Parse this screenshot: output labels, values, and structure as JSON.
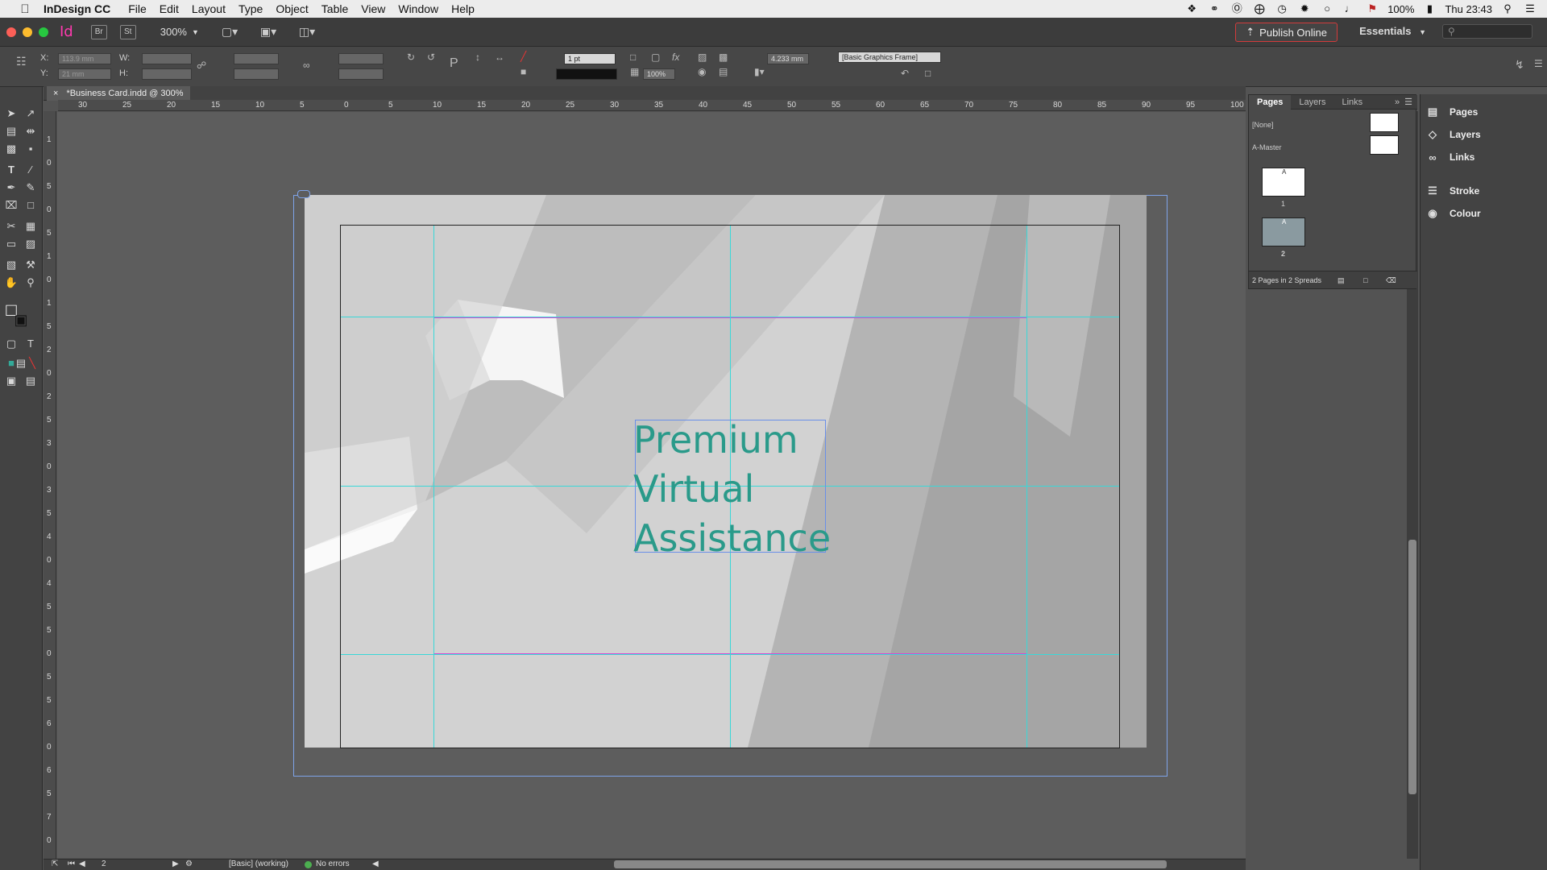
{
  "menubar": {
    "app_name": "InDesign CC",
    "items": [
      "File",
      "Edit",
      "Layout",
      "Type",
      "Object",
      "Table",
      "View",
      "Window",
      "Help"
    ],
    "battery": "100%",
    "clock": "Thu 23:43"
  },
  "appbar": {
    "logo": "Id",
    "bridge": "Br",
    "stock": "St",
    "zoom": "300%",
    "publish_label": "Publish Online",
    "workspace": "Essentials"
  },
  "control": {
    "x_label": "X:",
    "x_value": "113.9 mm",
    "y_label": "Y:",
    "y_value": "21 mm",
    "w_label": "W:",
    "h_label": "H:",
    "stroke_weight": "1 pt",
    "opacity": "100%",
    "offset": "4.233 mm",
    "object_style": "[Basic Graphics Frame]"
  },
  "document": {
    "tab_title": "*Business Card.indd @ 300%",
    "headline": "Premium\nVirtual\nAssistance"
  },
  "ruler": {
    "h_ticks": [
      "30",
      "25",
      "20",
      "15",
      "10",
      "5",
      "0",
      "5",
      "10",
      "15",
      "20",
      "25",
      "30",
      "35",
      "40",
      "45",
      "50",
      "55",
      "60",
      "65",
      "70",
      "75",
      "80",
      "85",
      "90",
      "95",
      "100"
    ],
    "v_ticks": [
      "1",
      "0",
      "5",
      "0",
      "5",
      "1",
      "0",
      "1",
      "5",
      "2",
      "0",
      "2",
      "5",
      "3",
      "0",
      "3",
      "5",
      "4",
      "0",
      "4",
      "5",
      "5",
      "0",
      "5",
      "5",
      "6",
      "0",
      "6",
      "5",
      "7",
      "0"
    ]
  },
  "pages_panel": {
    "tabs": [
      "Pages",
      "Layers",
      "Links"
    ],
    "none_label": "[None]",
    "master_label": "A-Master",
    "page1_number": "1",
    "page2_number": "2",
    "master_marker": "A",
    "footer": "2 Pages in 2 Spreads"
  },
  "dock": {
    "items": [
      "Pages",
      "Layers",
      "Links",
      "Stroke",
      "Colour"
    ]
  },
  "status": {
    "page": "2",
    "profile": "[Basic] (working)",
    "preflight": "No errors"
  },
  "colors": {
    "headline": "#2a9a8a",
    "margin_guide": "#d24bd2",
    "column_guide": "#39d8d8",
    "bleed_frame": "#7ea3e8",
    "preflight_ok": "#4caf50"
  }
}
